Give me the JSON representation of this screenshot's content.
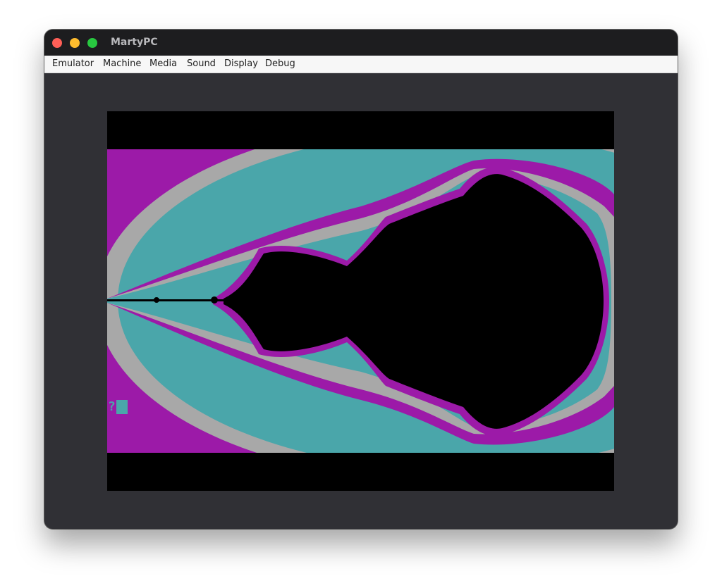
{
  "window": {
    "title": "MartyPC"
  },
  "menu": {
    "items": [
      {
        "label": "Emulator"
      },
      {
        "label": "Machine"
      },
      {
        "label": "Media"
      },
      {
        "label": "Sound"
      },
      {
        "label": "Display"
      },
      {
        "label": "Debug"
      }
    ]
  },
  "display": {
    "palette": {
      "magenta": "#9c1aa8",
      "grey": "#a8a8a8",
      "cyan": "#4aa6aa",
      "black": "#000000"
    },
    "prompt": {
      "char": "?"
    }
  }
}
